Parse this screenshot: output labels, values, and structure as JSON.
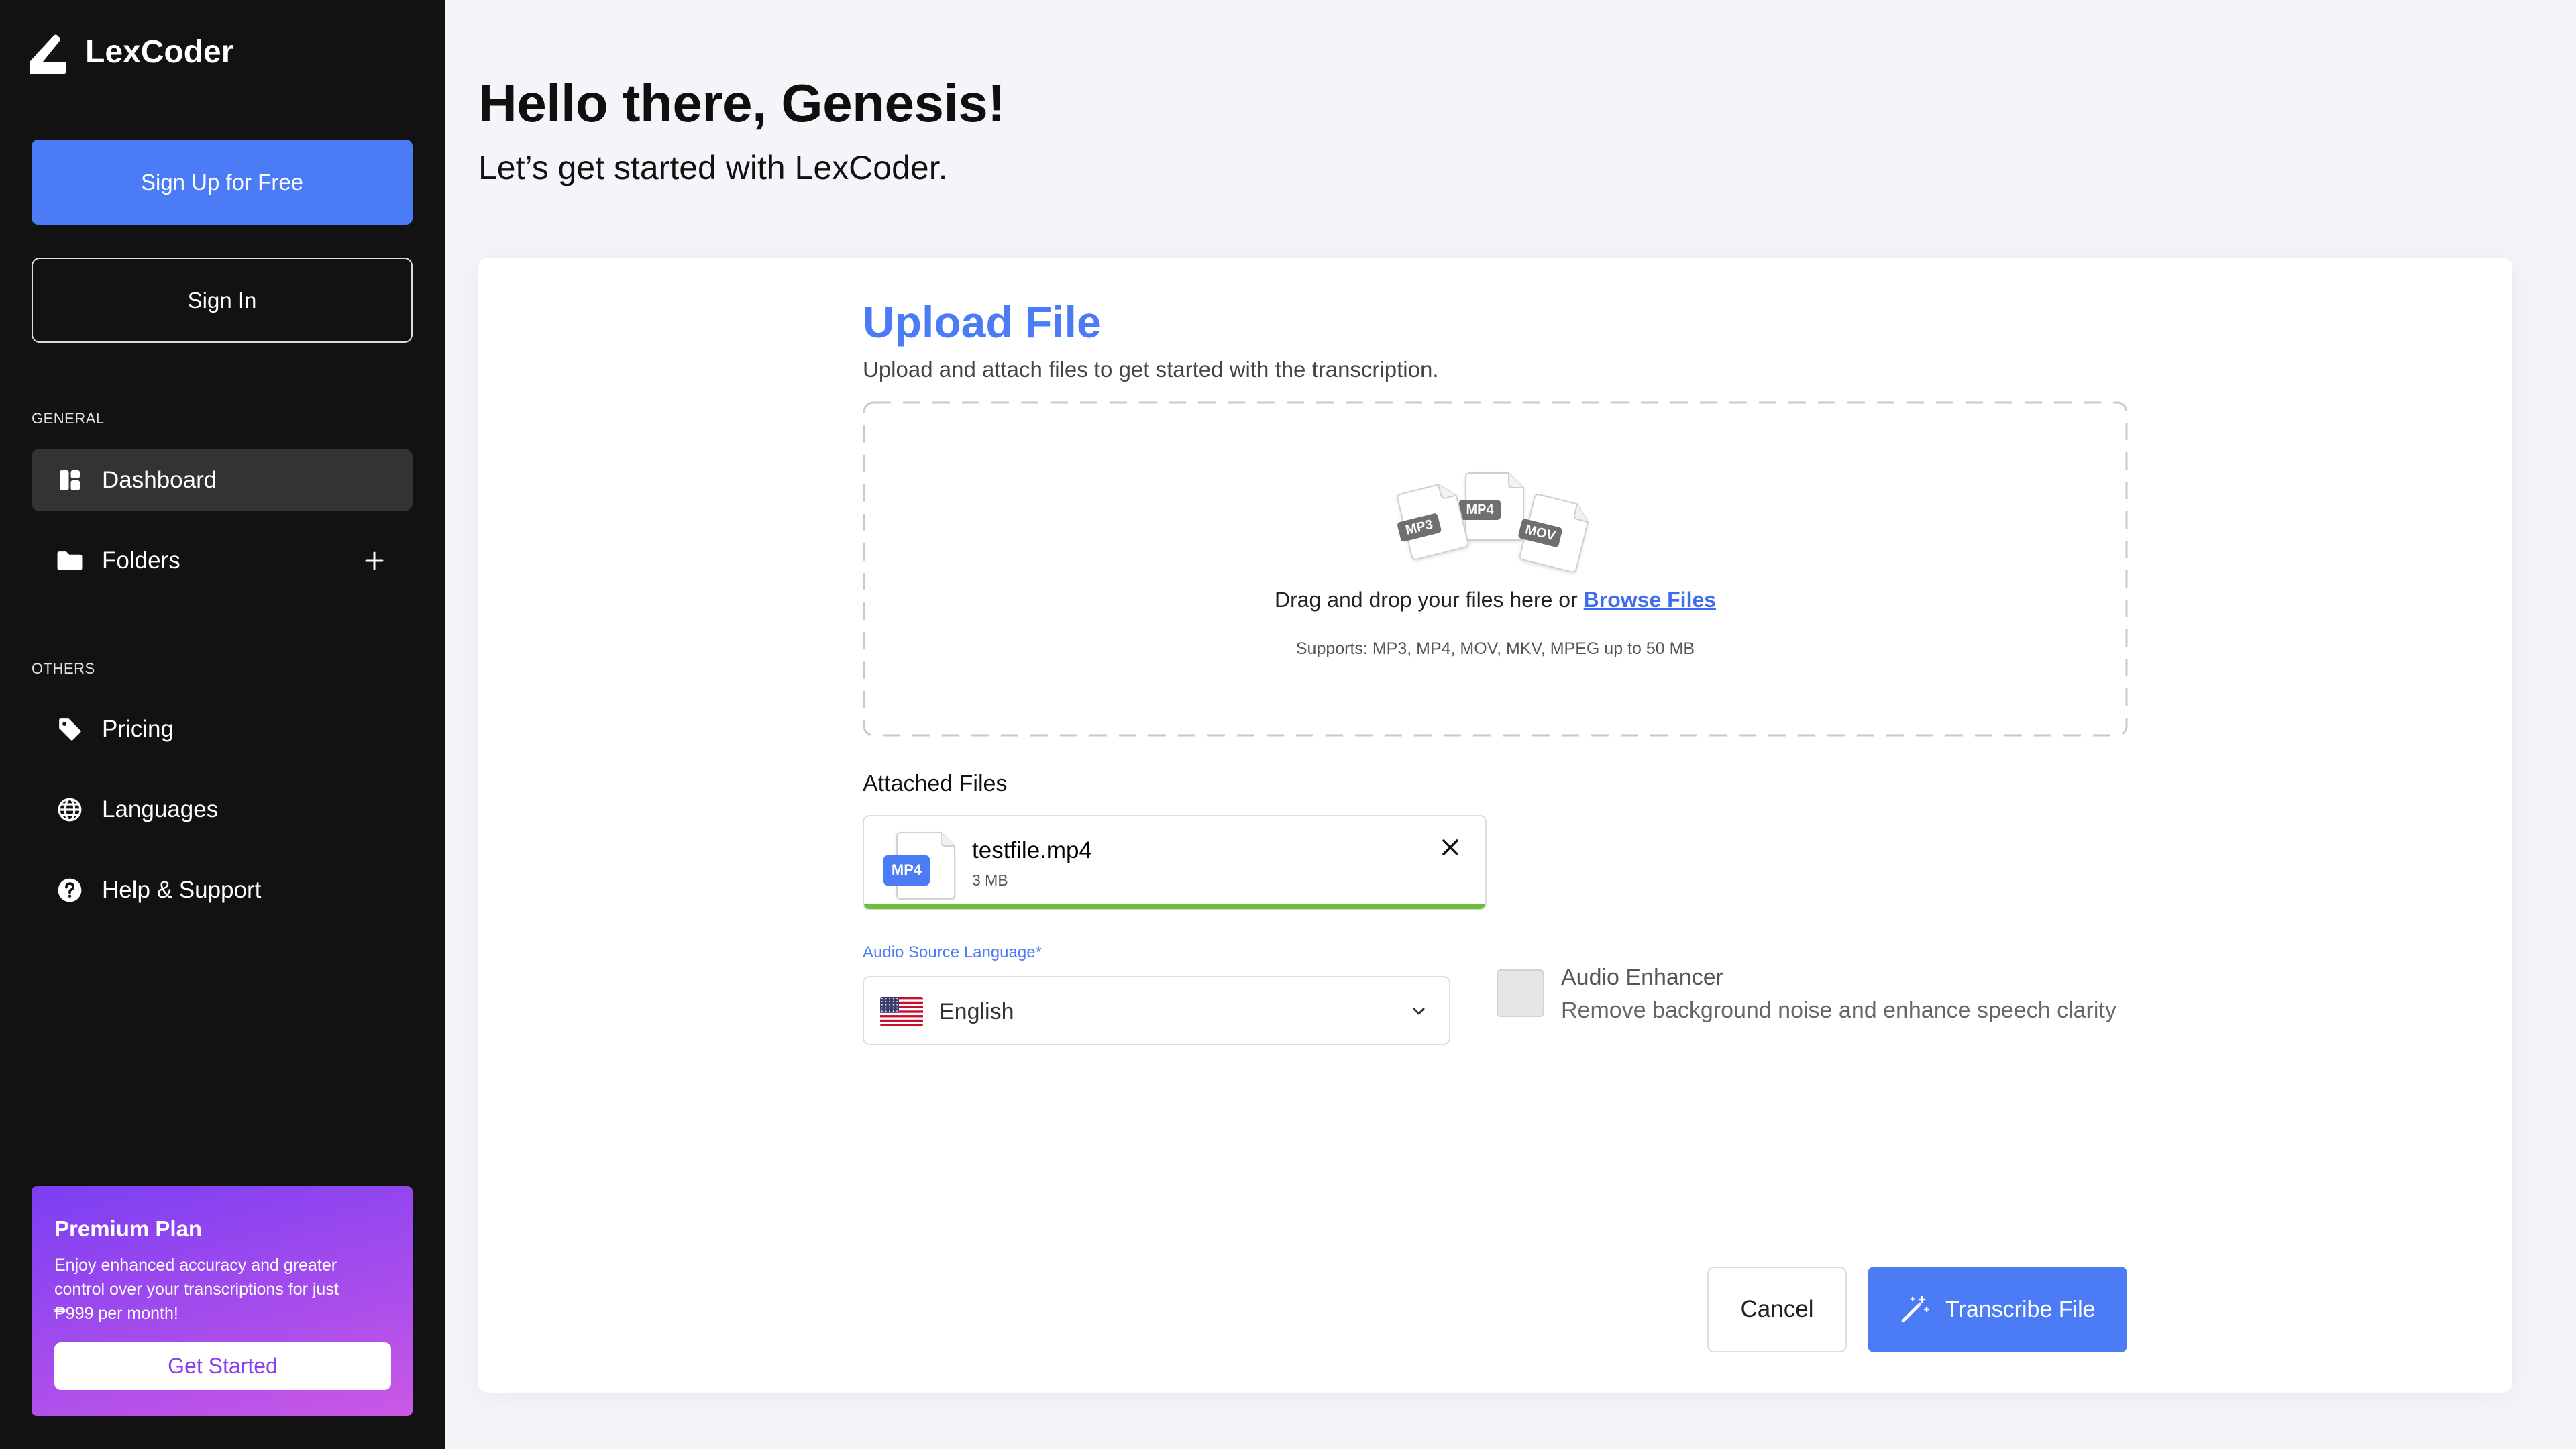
{
  "app": {
    "name": "LexCoder",
    "logo_icon": "lexcoder-logo-icon"
  },
  "sidebar": {
    "signup_label": "Sign Up for Free",
    "signin_label": "Sign In",
    "general": {
      "heading": "GENERAL",
      "items": [
        {
          "label": "Dashboard",
          "icon": "dashboard-icon",
          "active": true
        },
        {
          "label": "Folders",
          "icon": "folder-icon",
          "action_icon": "plus-icon",
          "active": false
        }
      ]
    },
    "others": {
      "heading": "OTHERS",
      "items": [
        {
          "label": "Pricing",
          "icon": "tag-icon",
          "active": false
        },
        {
          "label": "Languages",
          "icon": "globe-icon",
          "active": false
        },
        {
          "label": "Help & Support",
          "icon": "help-circle-icon",
          "active": false
        }
      ]
    },
    "premium": {
      "title": "Premium Plan",
      "description": "Enjoy enhanced accuracy and greater control over your transcriptions for just ₱999 per month!",
      "cta_label": "Get Started"
    }
  },
  "header": {
    "greeting": "Hello there, Genesis!",
    "subtitle": "Let’s get started with LexCoder."
  },
  "upload": {
    "title": "Upload File",
    "subtitle": "Upload and attach files to get started with the transcription.",
    "dropzone": {
      "file_type_badges": [
        "MP3",
        "MP4",
        "MOV"
      ],
      "prompt": "Drag and drop your files here or ",
      "browse_link": "Browse Files",
      "supports": "Supports: MP3, MP4, MOV, MKV, MPEG up to 50 MB"
    },
    "attached_heading": "Attached Files",
    "attached_files": [
      {
        "type_badge": "MP4",
        "name": "testfile.mp4",
        "size": "3 MB",
        "progress_percent": 100,
        "remove_icon": "close-icon"
      }
    ],
    "language": {
      "label": "Audio Source Language*",
      "selected": "English",
      "flag_icon": "us-flag-icon",
      "dropdown_icon": "chevron-down-icon"
    },
    "enhancer": {
      "title": "Audio Enhancer",
      "description": "Remove background noise and enhance speech clarity",
      "checked": false
    },
    "actions": {
      "cancel_label": "Cancel",
      "submit_label": "Transcribe File",
      "submit_icon": "magic-wand-icon"
    }
  },
  "colors": {
    "accent": "#4B7BF5",
    "sidebar_bg": "#121212",
    "sidebar_active_bg": "#333333",
    "page_bg": "#F3F5F9",
    "progress": "#6CBF3A",
    "premium_gradient_start": "#7B3FF2",
    "premium_gradient_end": "#CB58E6",
    "premium_cta_text": "#8A3FF0"
  }
}
